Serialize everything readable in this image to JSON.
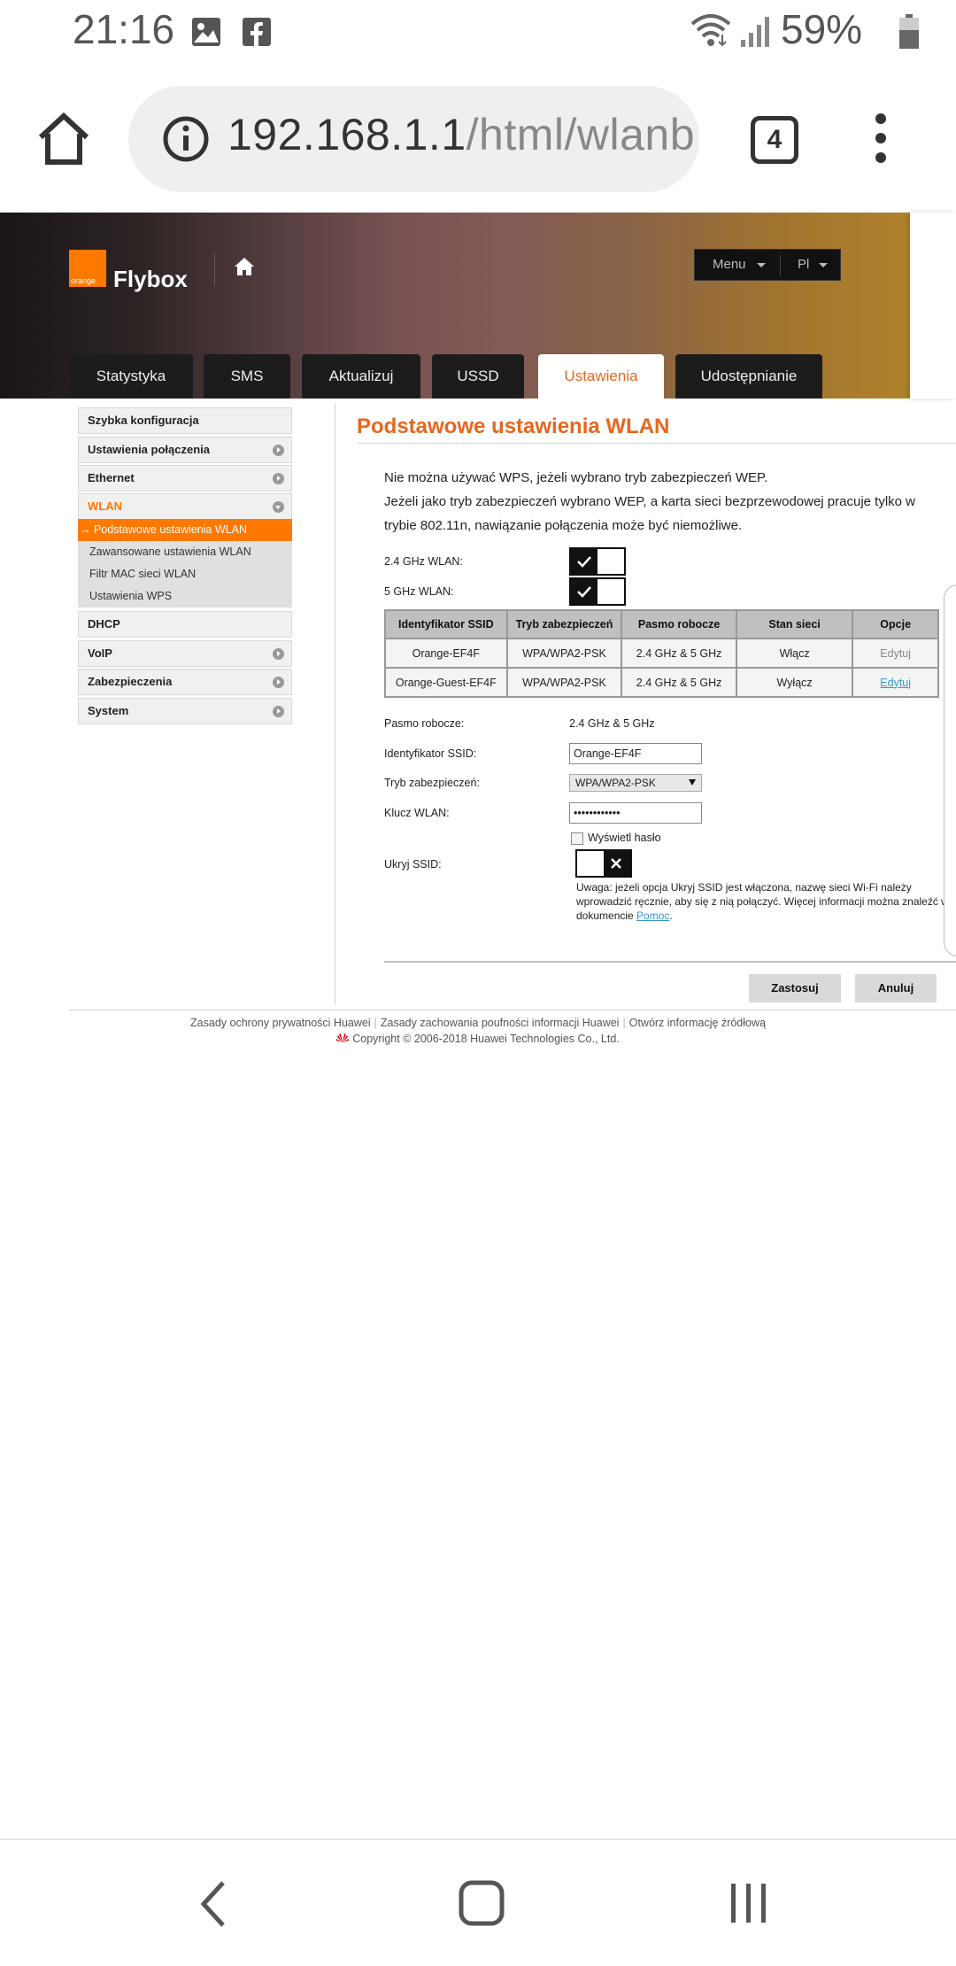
{
  "status_bar": {
    "time": "21:16",
    "battery": "59%"
  },
  "browser": {
    "url_host": "192.168.1.1",
    "url_path": "/html/wlanb",
    "tab_count": "4"
  },
  "header": {
    "logo_text": "orange",
    "brand": "Flybox",
    "menu_label": "Menu",
    "lang_label": "Pl"
  },
  "tabs": [
    {
      "label": "Statystyka"
    },
    {
      "label": "SMS"
    },
    {
      "label": "Aktualizuj"
    },
    {
      "label": "USSD"
    },
    {
      "label": "Ustawienia",
      "active": true
    },
    {
      "label": "Udostępnianie"
    }
  ],
  "sidebar": {
    "items": [
      {
        "label": "Szybka konfiguracja"
      },
      {
        "label": "Ustawienia połączenia"
      },
      {
        "label": "Ethernet"
      },
      {
        "label": "WLAN"
      },
      {
        "label": "DHCP"
      },
      {
        "label": "VoIP"
      },
      {
        "label": "Zabezpieczenia"
      },
      {
        "label": "System"
      }
    ],
    "wlan_sub": [
      {
        "label": "→ Podstawowe ustawienia WLAN",
        "active": true
      },
      {
        "label": "Zawansowane ustawienia WLAN"
      },
      {
        "label": "Filtr MAC sieci WLAN"
      },
      {
        "label": "Ustawienia WPS"
      }
    ]
  },
  "main": {
    "title": "Podstawowe ustawienia WLAN",
    "note1": "Nie można używać WPS, jeżeli wybrano tryb zabezpieczeń WEP.",
    "note2": "Jeżeli jako tryb zabezpieczeń wybrano WEP, a karta sieci bezprzewodowej pracuje tylko w trybie 802.11n, nawiązanie połączenia może być niemożliwe.",
    "wlan24_label": "2.4 GHz WLAN:",
    "wlan5_label": "5 GHz WLAN:",
    "table": {
      "headers": [
        "Identyfikator SSID",
        "Tryb zabezpieczeń",
        "Pasmo robocze",
        "Stan sieci",
        "Opcje"
      ],
      "rows": [
        [
          "Orange-EF4F",
          "WPA/WPA2-PSK",
          "2.4 GHz & 5 GHz",
          "Włącz",
          "Edytuj"
        ],
        [
          "Orange-Guest-EF4F",
          "WPA/WPA2-PSK",
          "2.4 GHz & 5 GHz",
          "Wyłącz",
          "Edytuj"
        ]
      ]
    },
    "form": {
      "band_label": "Pasmo robocze:",
      "band_value": "2.4 GHz & 5 GHz",
      "ssid_label": "Identyfikator SSID:",
      "ssid_value": "Orange-EF4F",
      "security_label": "Tryb zabezpieczeń:",
      "security_value": "WPA/WPA2-PSK",
      "key_label": "Klucz WLAN:",
      "key_value": "••••••••••••",
      "show_password": "Wyświetl hasło",
      "hide_ssid_label": "Ukryj SSID:",
      "warning_text": "Uwaga: jeżeli opcja Ukryj SSID jest włączona, nazwę sieci Wi-Fi należy wprowadzić ręcznie, aby się z nią połączyć. Więcej informacji można znaleźć w dokumencie ",
      "warning_link": "Pomoc",
      "warning_end": "."
    },
    "apply_label": "Zastosuj",
    "cancel_label": "Anuluj"
  },
  "footer": {
    "links": [
      "Zasady ochrony prywatności Huawei",
      "Zasady zachowania poufności informacji Huawei",
      "Otwórz informację źródłową"
    ],
    "copyright": "Copyright © 2006-2018 Huawei Technologies Co., Ltd."
  },
  "icons": {
    "status": [
      "image-icon",
      "facebook-icon",
      "wifi-icon",
      "signal-icon",
      "battery-icon"
    ],
    "nav": [
      "back-icon",
      "home-icon",
      "recents-icon"
    ]
  },
  "colors": {
    "accent": "#ff7900",
    "title": "#e8661e",
    "link": "#3399cc"
  }
}
